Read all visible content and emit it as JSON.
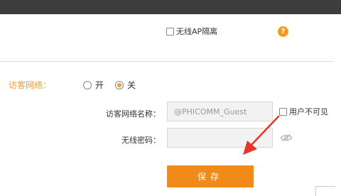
{
  "header": {
    "bar_color": "#3d3d3d"
  },
  "wireless": {
    "ap_isolation_label": "无线AP隔离",
    "help_icon": "?"
  },
  "guest_network": {
    "label": "访客网络：",
    "options": [
      {
        "label": "开",
        "selected": false
      },
      {
        "label": "关",
        "selected": true
      }
    ],
    "name_label": "访客网络名称：",
    "name_placeholder": "@PHICOMM_Guest",
    "hide_user_label": "用户不可见",
    "password_label": "无线密码：",
    "password_value": ""
  },
  "actions": {
    "save_label": "保存"
  },
  "colors": {
    "accent": "#f28a1a",
    "label_orange": "#e8a040",
    "arrow_red": "#e8352a"
  },
  "icons": {
    "eye": "eye-slash-icon",
    "help": "question-icon"
  }
}
